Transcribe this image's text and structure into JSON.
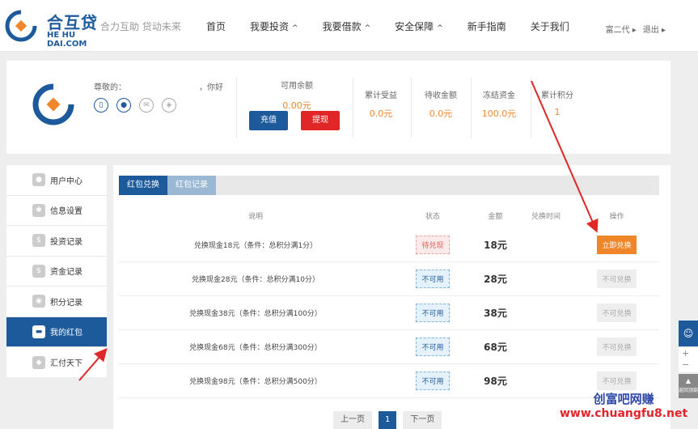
{
  "header": {
    "logo_cn": "合互贷",
    "logo_en": "HE HU DAI.COM",
    "slogan": "合力互助 贷动未来",
    "nav": [
      {
        "label": "首页",
        "caret": ""
      },
      {
        "label": "我要投资",
        "caret": "^"
      },
      {
        "label": "我要借款",
        "caret": "^"
      },
      {
        "label": "安全保障",
        "caret": "^"
      },
      {
        "label": "新手指南",
        "caret": ""
      },
      {
        "label": "关于我们",
        "caret": ""
      }
    ],
    "user_name": "富二代 ▸",
    "logout": "退出 ▸"
  },
  "account": {
    "greeting_prefix": "尊敬的：",
    "greeting_suffix": "，你好",
    "balance_label": "可用余额",
    "balance_value": "0.00元",
    "recharge_label": "充值",
    "withdraw_label": "提现",
    "stats": [
      {
        "label": "累计受益",
        "value": "0.0元"
      },
      {
        "label": "待收金额",
        "value": "0.0元"
      },
      {
        "label": "冻结资金",
        "value": "100.0元"
      },
      {
        "label": "累计积分",
        "value": "1"
      }
    ]
  },
  "sidebar": {
    "items": [
      {
        "label": "用户中心",
        "icon": "user-icon"
      },
      {
        "label": "信息设置",
        "icon": "gear-icon"
      },
      {
        "label": "投资记录",
        "icon": "money-bag-icon"
      },
      {
        "label": "资金记录",
        "icon": "money-bag-icon"
      },
      {
        "label": "积分记录",
        "icon": "points-icon"
      },
      {
        "label": "我的红包",
        "icon": "card-icon"
      },
      {
        "label": "汇付天下",
        "icon": "shield-icon"
      }
    ]
  },
  "tabs": {
    "redeem": "红包兑换",
    "records": "红包记录"
  },
  "table": {
    "headers": [
      "说明",
      "状态",
      "金额",
      "兑换时间",
      "操作"
    ],
    "rows": [
      {
        "desc": "兑换现金18元（条件：总积分满1分）",
        "status": "待兑现",
        "amount": "18元",
        "time": "",
        "action": "立即兑换"
      },
      {
        "desc": "兑换现金28元（条件：总积分满10分）",
        "status": "不可用",
        "amount": "28元",
        "time": "",
        "action": "不可兑换"
      },
      {
        "desc": "兑换现金38元（条件：总积分满100分）",
        "status": "不可用",
        "amount": "38元",
        "time": "",
        "action": "不可兑换"
      },
      {
        "desc": "兑换现金68元（条件：总积分满300分）",
        "status": "不可用",
        "amount": "68元",
        "time": "",
        "action": "不可兑换"
      },
      {
        "desc": "兑换现金98元（条件：总积分满500分）",
        "status": "不可用",
        "amount": "98元",
        "time": "",
        "action": "不可兑换"
      }
    ]
  },
  "pager": {
    "prev": "上一页",
    "current": "1",
    "next": "下一页"
  },
  "floats": {
    "zoom_in": "+",
    "zoom_out": "−",
    "back_top": "返回顶部"
  },
  "watermark": {
    "line1": "创富吧网赚",
    "line2": "www.chuangfu8.net"
  },
  "colors": {
    "brand": "#1d5a9b",
    "accent": "#f0862a",
    "danger": "#e02626"
  }
}
